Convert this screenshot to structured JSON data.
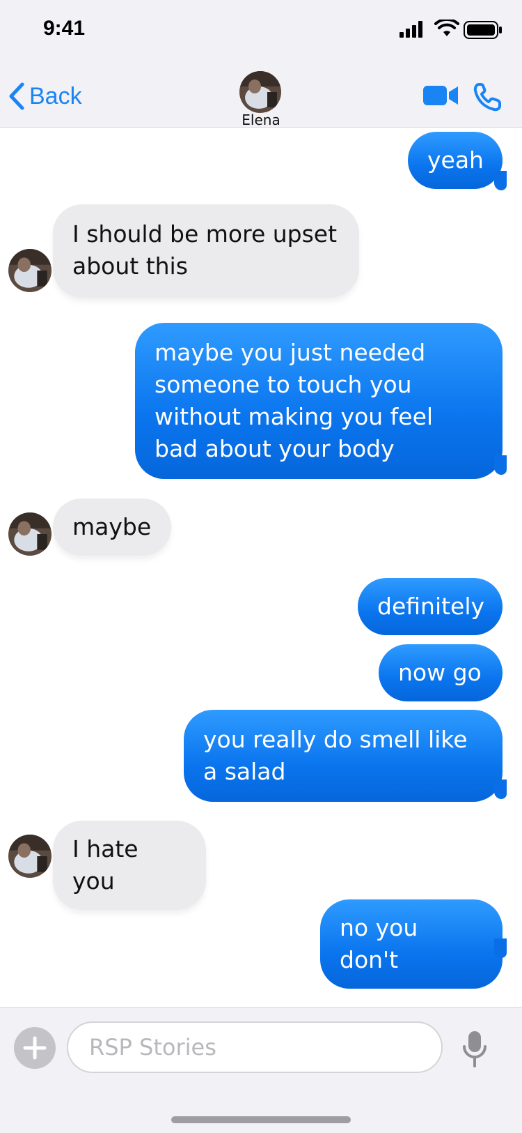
{
  "status_bar": {
    "time": "9:41"
  },
  "nav": {
    "back_label": "Back",
    "contact_name": "Elena"
  },
  "colors": {
    "accent": "#1a84f5",
    "outgoing_bubble": "#0a75ee",
    "incoming_bubble": "#ebebee"
  },
  "messages": [
    {
      "direction": "out",
      "text": "yeah"
    },
    {
      "direction": "in",
      "text": "I should be more upset about this"
    },
    {
      "direction": "out",
      "text": "maybe you just needed someone to touch you without making you feel bad about your body"
    },
    {
      "direction": "in",
      "text": "maybe"
    },
    {
      "direction": "out",
      "text": "definitely"
    },
    {
      "direction": "out",
      "text": "now go"
    },
    {
      "direction": "out",
      "text": "you really do smell like a salad"
    },
    {
      "direction": "in",
      "text": "I hate you"
    },
    {
      "direction": "out",
      "text": "no you don't"
    }
  ],
  "input": {
    "placeholder": "RSP Stories"
  },
  "icons": {
    "signal": "cellular-signal-icon",
    "wifi": "wifi-icon",
    "battery": "battery-icon",
    "back": "chevron-left-icon",
    "video": "video-camera-icon",
    "phone": "phone-icon",
    "add": "plus-icon",
    "mic": "microphone-icon"
  }
}
